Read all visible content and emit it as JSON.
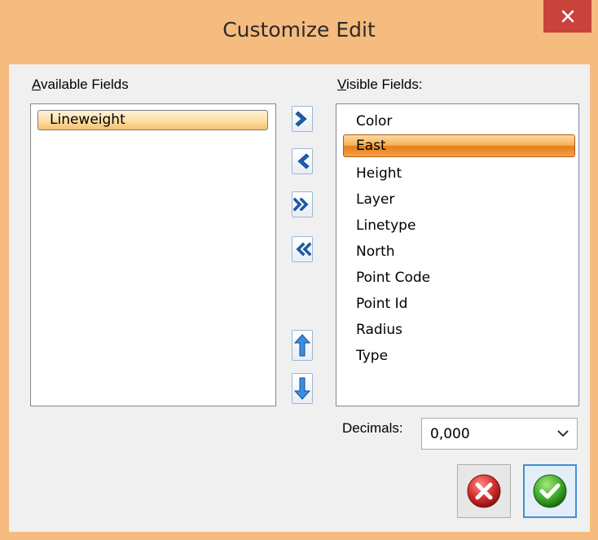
{
  "window": {
    "title": "Customize Edit",
    "close_icon": "close-icon"
  },
  "available": {
    "label_accel": "A",
    "label_rest": "vailable Fields",
    "items": [
      {
        "label": "Lineweight",
        "selected": true
      }
    ]
  },
  "visible": {
    "label_accel": "V",
    "label_rest": "isible Fields:",
    "items": [
      {
        "label": "Color"
      },
      {
        "label": "East",
        "selected": true
      },
      {
        "label": "Height"
      },
      {
        "label": "Layer"
      },
      {
        "label": "Linetype"
      },
      {
        "label": "North"
      },
      {
        "label": "Point Code"
      },
      {
        "label": "Point Id"
      },
      {
        "label": "Radius"
      },
      {
        "label": "Type"
      }
    ]
  },
  "buttons": {
    "move_right": "chevron-right-icon",
    "move_left": "chevron-left-icon",
    "move_all_right": "double-chevron-right-icon",
    "move_all_left": "double-chevron-left-icon",
    "move_up": "arrow-up-icon",
    "move_down": "arrow-down-icon",
    "cancel": "cancel-x-icon",
    "ok": "checkmark-icon"
  },
  "decimals": {
    "label": "Decimals:",
    "value": "0,000"
  },
  "colors": {
    "accent_orange": "#f6bb7e",
    "close_red": "#c9423b",
    "arrow_blue": "#1a5fb4"
  }
}
